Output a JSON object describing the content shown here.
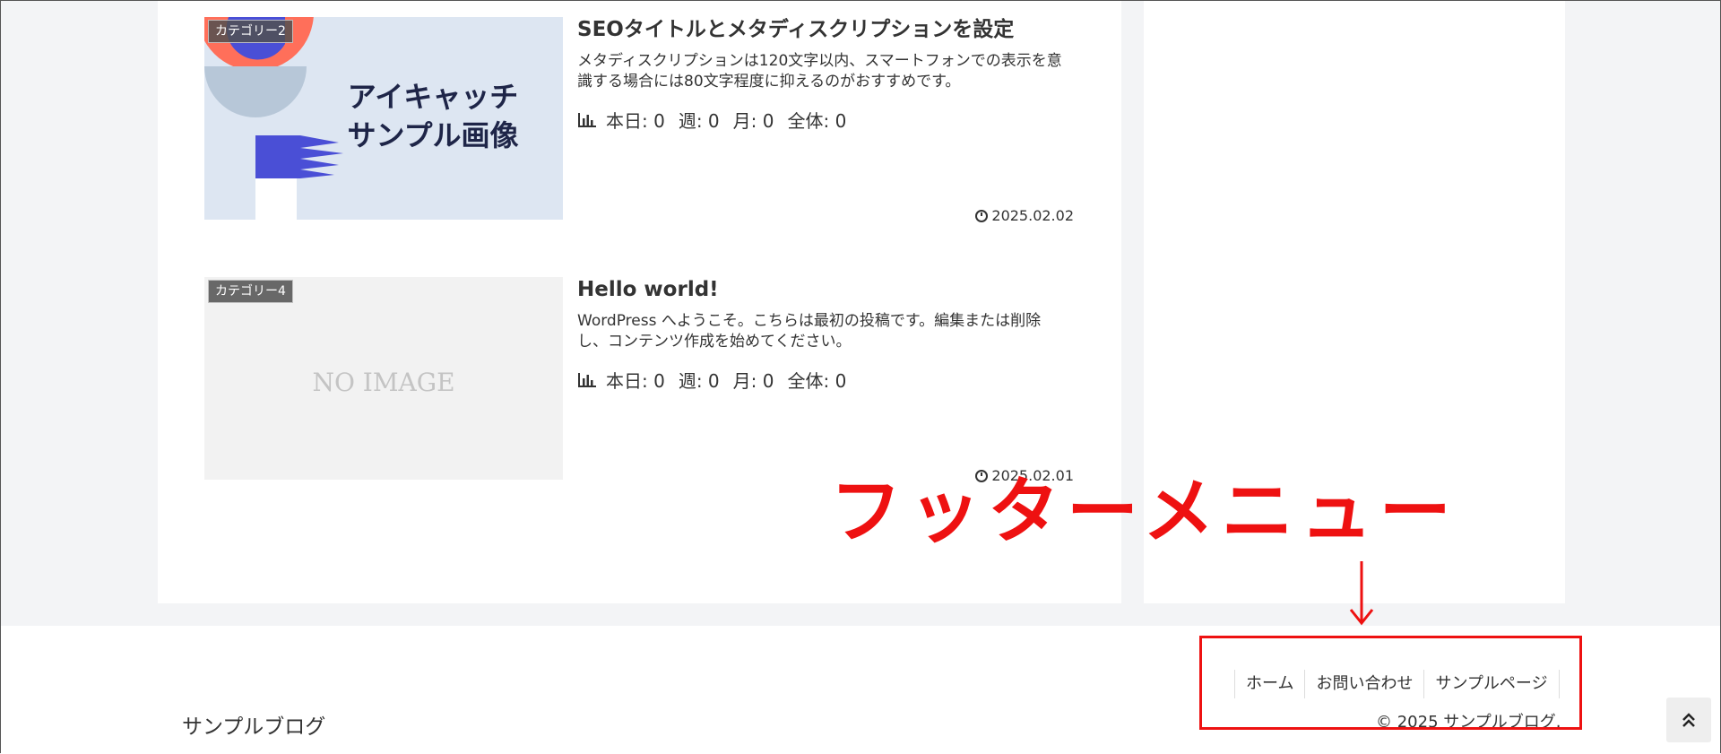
{
  "posts": [
    {
      "category": "カテゴリー2",
      "title": "SEOタイトルとメタディスクリプションを設定",
      "excerpt": "メタディスクリプションは120文字以内、スマートフォンでの表示を意識する場合には80文字程度に抑えるのがおすすめです。",
      "thumbnail_text_line1": "アイキャッチ",
      "thumbnail_text_line2": "サンプル画像",
      "stats": {
        "today": "本日: 0",
        "week": "週: 0",
        "month": "月: 0",
        "total": "全体: 0"
      },
      "date": "2025.02.02"
    },
    {
      "category": "カテゴリー4",
      "title": "Hello world!",
      "excerpt": "WordPress へようこそ。こちらは最初の投稿です。編集または削除し、コンテンツ作成を始めてください。",
      "thumbnail_text": "NO IMAGE",
      "stats": {
        "today": "本日: 0",
        "week": "週: 0",
        "month": "月: 0",
        "total": "全体: 0"
      },
      "date": "2025.02.01"
    }
  ],
  "annotation": {
    "label": "フッターメニュー"
  },
  "footer": {
    "site_name": "サンプルブログ",
    "menu": [
      "ホーム",
      "お問い合わせ",
      "サンプルページ"
    ],
    "copyright": "© 2025 サンプルブログ."
  },
  "colors": {
    "annotation_red": "#ee1111",
    "page_bg": "#f3f4f6",
    "card_bg": "#ffffff"
  },
  "icons": {
    "stats": "bar-chart-icon",
    "date": "clock-icon",
    "to_top": "double-chevron-up-icon"
  }
}
